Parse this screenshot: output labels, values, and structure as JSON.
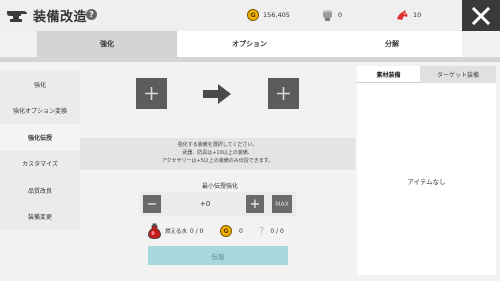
{
  "header": {
    "title": "装備改造",
    "help_icon": "question-icon",
    "resources": [
      {
        "icon": "gold-coin-icon",
        "value": "156,405"
      },
      {
        "icon": "fist-icon",
        "value": "0"
      },
      {
        "icon": "dragon-icon",
        "value": "10"
      }
    ],
    "close_icon": "close-icon"
  },
  "tabs": [
    {
      "label": "強化",
      "active": true
    },
    {
      "label": "オプション",
      "active": false
    },
    {
      "label": "分解",
      "active": false
    }
  ],
  "sidebar": {
    "items": [
      {
        "label": "強化",
        "active": false
      },
      {
        "label": "強化オプション変換",
        "active": false
      },
      {
        "label": "強化伝授",
        "active": true
      },
      {
        "label": "カスタマイズ",
        "active": false
      },
      {
        "label": "品質改良",
        "active": false
      },
      {
        "label": "装備変更",
        "active": false
      }
    ]
  },
  "transfer": {
    "source_slot_icon": "plus-icon",
    "arrow_icon": "arrow-right-icon",
    "target_slot_icon": "plus-icon",
    "hint_line1": "強化する装備を選択してください。",
    "hint_line2": "武器、防具は+10以上の装備、",
    "hint_line3": "アクセサリーは+5以上の装備のみ伝授できます。"
  },
  "min_transfer": {
    "label": "最小伝授強化",
    "minus_label": "−",
    "value": "+0",
    "plus_label": "+",
    "max_label": "MAX"
  },
  "costs": [
    {
      "icon": "potion-icon",
      "label": "燃える水",
      "value": "0 / 0"
    },
    {
      "icon": "gold-coin-icon",
      "label": "",
      "value": "0"
    },
    {
      "icon": "unknown-item-icon",
      "label": "",
      "value": "0 / 0"
    }
  ],
  "submit_label": "伝授",
  "right_panel": {
    "tabs": [
      {
        "label": "素材装備",
        "active": true
      },
      {
        "label": "ターゲット装備",
        "active": false
      }
    ],
    "empty_text": "アイテムなし"
  },
  "colors": {
    "coin": "#f0b400",
    "close_bg": "#3a3a3a",
    "submit_bg": "#a8d8dc",
    "dragon": "#e03030"
  }
}
